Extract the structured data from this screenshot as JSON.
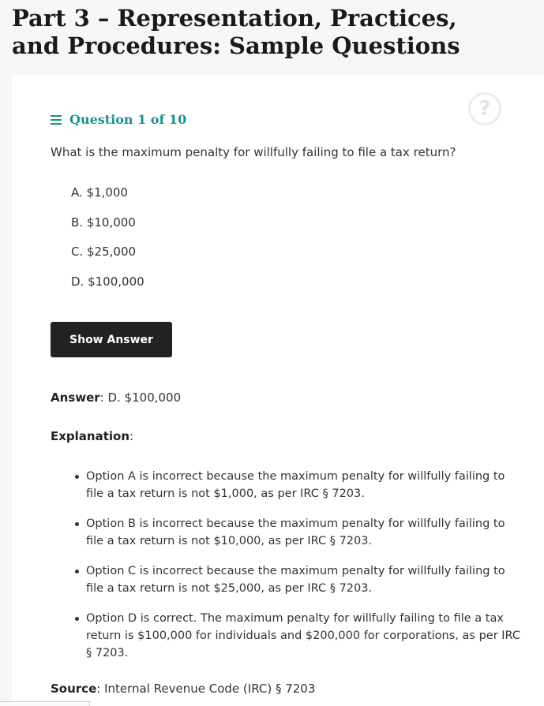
{
  "page": {
    "title": "Part 3 – Representation, Practices, and Procedures: Sample Questions"
  },
  "quiz": {
    "header": "Question 1 of 10",
    "help_icon": "?",
    "question": "What is the maximum penalty for willfully failing to file a tax return?",
    "options": [
      "A. $1,000",
      "B. $10,000",
      "C. $25,000",
      "D. $100,000"
    ],
    "show_answer_label": "Show Answer",
    "answer_label": "Answer",
    "answer_value": ": D. $100,000",
    "explanation_label": "Explanation",
    "explanation_colon": ":",
    "explanations": [
      "Option A is incorrect because the maximum penalty for willfully failing to file a tax return is not $1,000, as per IRC § 7203.",
      "Option B is incorrect because the maximum penalty for willfully failing to file a tax return is not $10,000, as per IRC § 7203.",
      "Option C is incorrect because the maximum penalty for willfully failing to file a tax return is not $25,000, as per IRC § 7203.",
      "Option D is correct. The maximum penalty for willfully failing to file a tax return is $100,000 for individuals and $200,000 for corporations, as per IRC § 7203."
    ],
    "source_label": "Source",
    "source_value": ": Internal Revenue Code (IRC) § 7203"
  },
  "icons": {
    "menu": "menu-icon",
    "help": "help-icon"
  },
  "colors": {
    "accent": "#17948a",
    "button_bg": "#222222",
    "page_bg": "#f7f7f7",
    "card_bg": "#ffffff"
  }
}
